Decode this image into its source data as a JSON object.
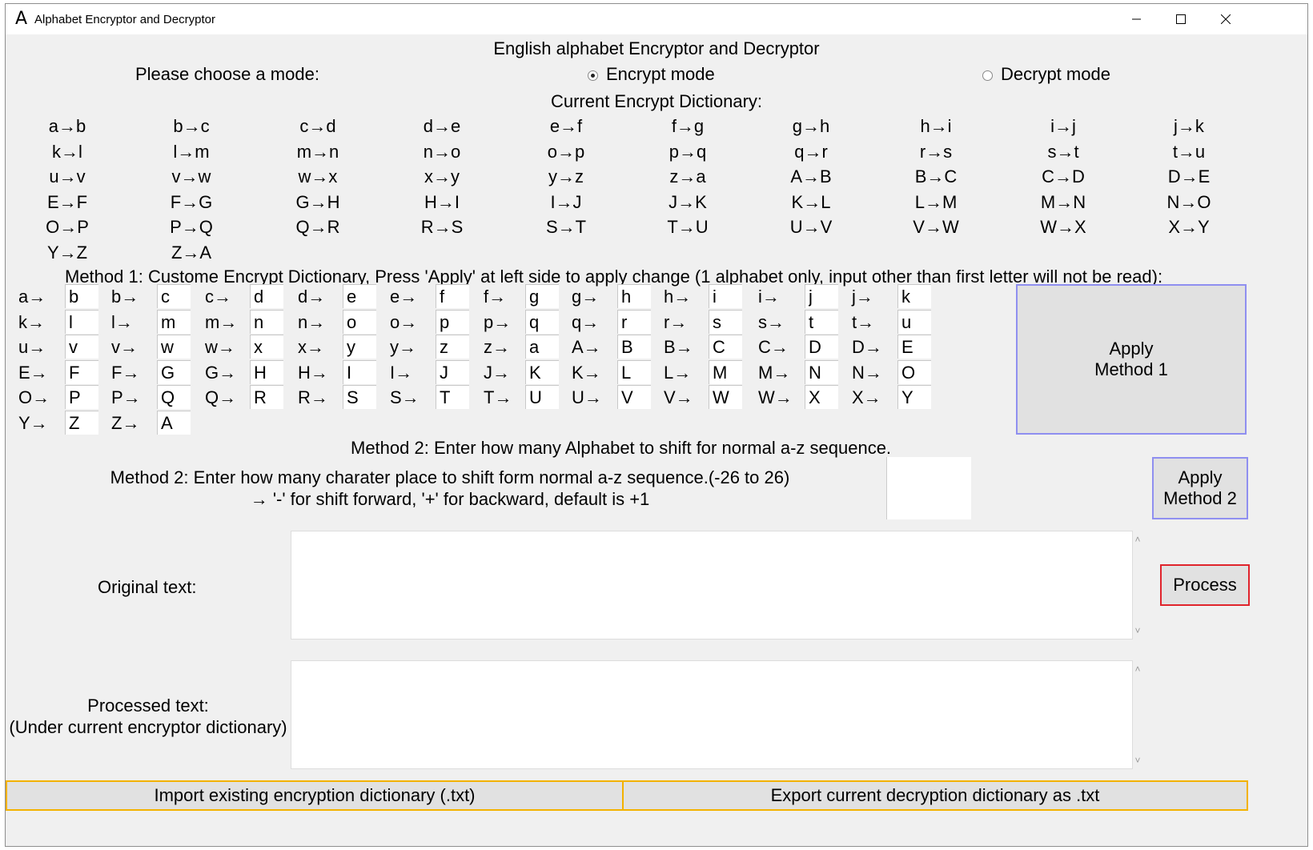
{
  "window": {
    "title": "Alphabet Encryptor and Decryptor",
    "icon": "A"
  },
  "header": {
    "title": "English alphabet Encryptor and Decryptor"
  },
  "mode": {
    "prompt": "Please choose a mode:",
    "options": [
      {
        "label": "Encrypt mode",
        "selected": true
      },
      {
        "label": "Decrypt mode",
        "selected": false
      }
    ]
  },
  "dictionary": {
    "title": "Current Encrypt Dictionary:",
    "entries": [
      "a→b",
      "b→c",
      "c→d",
      "d→e",
      "e→f",
      "f→g",
      "g→h",
      "h→i",
      "i→j",
      "j→k",
      "k→l",
      "l→m",
      "m→n",
      "n→o",
      "o→p",
      "p→q",
      "q→r",
      "r→s",
      "s→t",
      "t→u",
      "u→v",
      "v→w",
      "w→x",
      "x→y",
      "y→z",
      "z→a",
      "A→B",
      "B→C",
      "C→D",
      "D→E",
      "E→F",
      "F→G",
      "G→H",
      "H→I",
      "I→J",
      "J→K",
      "K→L",
      "L→M",
      "M→N",
      "N→O",
      "O→P",
      "P→Q",
      "Q→R",
      "R→S",
      "S→T",
      "T→U",
      "U→V",
      "V→W",
      "W→X",
      "X→Y",
      "Y→Z",
      "Z→A"
    ]
  },
  "method1": {
    "title": "Method 1: Custome Encrypt Dictionary, Press 'Apply' at left side to apply change (1 alphabet only, input other than first letter will not be read):",
    "labels": [
      "a→",
      "b→",
      "c→",
      "d→",
      "e→",
      "f→",
      "g→",
      "h→",
      "i→",
      "j→",
      "k→",
      "l→",
      "m→",
      "n→",
      "o→",
      "p→",
      "q→",
      "r→",
      "s→",
      "t→",
      "u→",
      "v→",
      "w→",
      "x→",
      "y→",
      "z→",
      "A→",
      "B→",
      "C→",
      "D→",
      "E→",
      "F→",
      "G→",
      "H→",
      "I→",
      "J→",
      "K→",
      "L→",
      "M→",
      "N→",
      "O→",
      "P→",
      "Q→",
      "R→",
      "S→",
      "T→",
      "U→",
      "V→",
      "W→",
      "X→",
      "Y→",
      "Z→"
    ],
    "values": [
      "b",
      "c",
      "d",
      "e",
      "f",
      "g",
      "h",
      "i",
      "j",
      "k",
      "l",
      "m",
      "n",
      "o",
      "p",
      "q",
      "r",
      "s",
      "t",
      "u",
      "v",
      "w",
      "x",
      "y",
      "z",
      "a",
      "B",
      "C",
      "D",
      "E",
      "F",
      "G",
      "H",
      "I",
      "J",
      "K",
      "L",
      "M",
      "N",
      "O",
      "P",
      "Q",
      "R",
      "S",
      "T",
      "U",
      "V",
      "W",
      "X",
      "Y",
      "Z",
      "A"
    ],
    "apply_line1": "Apply",
    "apply_line2": "Method 1"
  },
  "method2": {
    "title": "Method 2: Enter how many Alphabet to shift for normal a-z sequence.",
    "instruction_line1": "Method 2: Enter how many charater place to shift form normal a-z sequence.(-26 to 26)",
    "instruction_line2": "→ '-' for shift forward, '+' for backward, default is +1",
    "shift_value": "",
    "apply_line1": "Apply",
    "apply_line2": "Method 2"
  },
  "io": {
    "original_label": "Original text:",
    "processed_label_line1": "Processed text:",
    "processed_label_line2": "(Under current encryptor dictionary)",
    "original_value": "",
    "processed_value": "",
    "process_button": "Process"
  },
  "footer": {
    "import_button": "Import existing encryption dictionary (.txt)",
    "export_button": "Export current decryption dictionary as .txt"
  },
  "colors": {
    "apply_border": "#8f8ff0",
    "process_border": "#e0242c",
    "footer_border": "#f3b200"
  }
}
